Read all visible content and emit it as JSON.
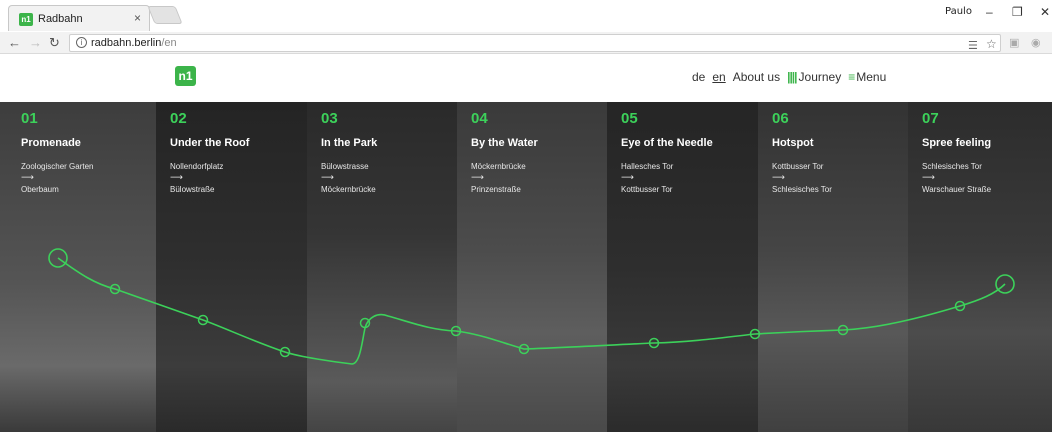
{
  "browser": {
    "tab_title": "Radbahn",
    "tab_favicon": "n1",
    "tab_close": "×",
    "user_badge": "Paulo",
    "minimize": "–",
    "maximize": "❐",
    "close": "✕",
    "url_host": "radbahn.berlin",
    "url_path": "/en"
  },
  "site": {
    "logo_text": "n1",
    "nav": {
      "lang_de": "de",
      "lang_en": "en",
      "about": "About us",
      "journey": "Journey",
      "menu": "Menu"
    }
  },
  "columns": [
    {
      "num": "01",
      "title": "Promenade",
      "from": "Zoologischer Garten",
      "arrow": "⟶",
      "to": "Oberbaum"
    },
    {
      "num": "02",
      "title": "Under the Roof",
      "from": "Nollendorfplatz",
      "arrow": "⟶",
      "to": "Bülowstraße"
    },
    {
      "num": "03",
      "title": "In the Park",
      "from": "Bülowstrasse",
      "arrow": "⟶",
      "to": "Möckernbrücke"
    },
    {
      "num": "04",
      "title": "By the Water",
      "from": "Möckernbrücke",
      "arrow": "⟶",
      "to": "Prinzenstraße"
    },
    {
      "num": "05",
      "title": "Eye of the Needle",
      "from": "Hallesches Tor",
      "arrow": "⟶",
      "to": "Kottbusser Tor"
    },
    {
      "num": "06",
      "title": "Hotspot",
      "from": "Kottbusser Tor",
      "arrow": "⟶",
      "to": "Schlesisches Tor"
    },
    {
      "num": "07",
      "title": "Spree feeling",
      "from": "Schlesisches Tor",
      "arrow": "⟶",
      "to": "Warschauer Straße"
    }
  ],
  "colors": {
    "accent": "#3cd15a",
    "brand": "#3cb44a"
  }
}
